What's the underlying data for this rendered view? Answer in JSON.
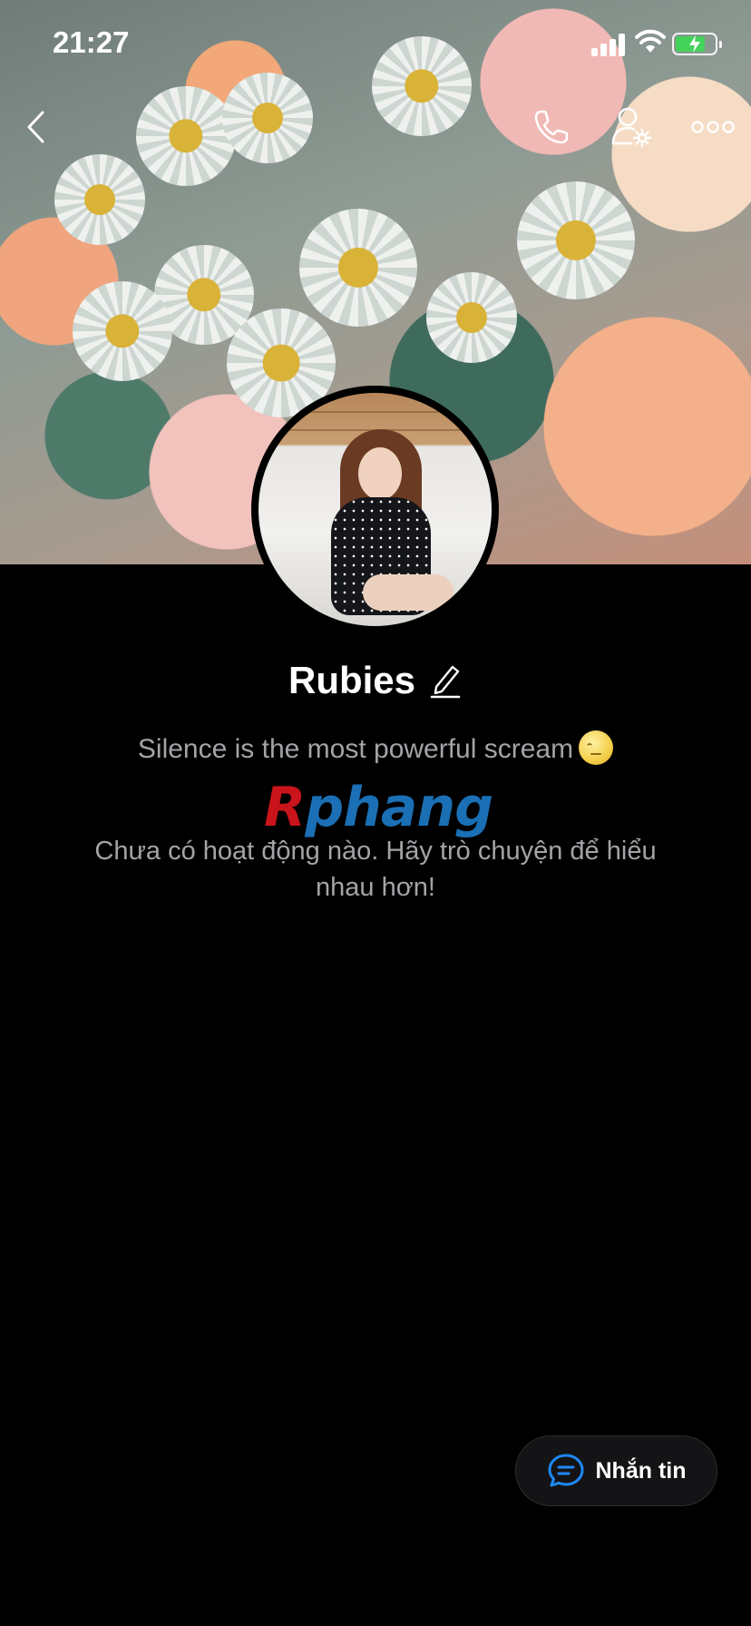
{
  "status_bar": {
    "time": "21:27"
  },
  "header": {
    "back_icon": "chevron-left-icon",
    "call_icon": "phone-icon",
    "profile_settings_icon": "user-settings-icon",
    "more_icon": "more-horizontal-icon"
  },
  "profile": {
    "name": "Rubies",
    "bio": "Silence is the most powerful scream",
    "bio_emoji": "neutral-face-emoji",
    "empty_activity": "Chưa có hoạt động nào. Hãy trò chuyện để hiểu nhau hơn!"
  },
  "watermark": {
    "first": "R",
    "rest": "phang"
  },
  "actions": {
    "message_label": "Nhắn tin",
    "message_icon": "chat-bubble-icon"
  },
  "colors": {
    "accent": "#1e88f5",
    "battery": "#43d25a",
    "background": "#000000",
    "muted_text": "#a3a3a8"
  }
}
